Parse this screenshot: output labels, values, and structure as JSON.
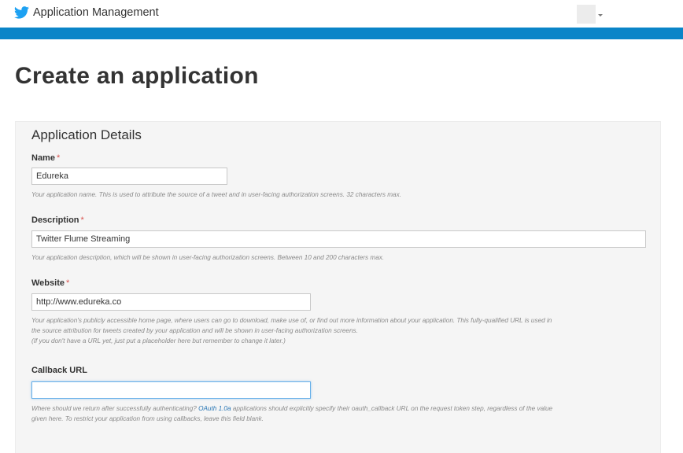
{
  "header": {
    "app_title": "Application Management"
  },
  "page": {
    "title": "Create an application"
  },
  "form": {
    "section_title": "Application Details",
    "name": {
      "label": "Name",
      "required_marker": "*",
      "value": "Edureka",
      "help": "Your application name. This is used to attribute the source of a tweet and in user-facing authorization screens. 32 characters max."
    },
    "description": {
      "label": "Description",
      "required_marker": "*",
      "value": "Twitter Flume Streaming",
      "help": "Your application description, which will be shown in user-facing authorization screens. Between 10 and 200 characters max."
    },
    "website": {
      "label": "Website",
      "required_marker": "*",
      "value": "http://www.edureka.co",
      "help_line1": "Your application's publicly accessible home page, where users can go to download, make use of, or find out more information about your application. This fully-qualified URL is used in",
      "help_line2": "the source attribution for tweets created by your application and will be shown in user-facing authorization screens.",
      "help_line3": "(If you don't have a URL yet, just put a placeholder here but remember to change it later.)"
    },
    "callback": {
      "label": "Callback URL",
      "value": "",
      "help_before_link": "Where should we return after successfully authenticating? ",
      "help_link": "OAuth 1.0a",
      "help_after_link": " applications should explicitly specify their oauth_callback URL on the request token step, regardless of the value",
      "help_line2": "given here. To restrict your application from using callbacks, leave this field blank."
    }
  },
  "colors": {
    "accent_bar": "#0b85c8",
    "twitter_blue": "#1da1f2",
    "required": "#d9534f",
    "link": "#2a77b5"
  },
  "icons": {
    "brand": "twitter-bird-icon",
    "menu": "caret-down-icon"
  }
}
